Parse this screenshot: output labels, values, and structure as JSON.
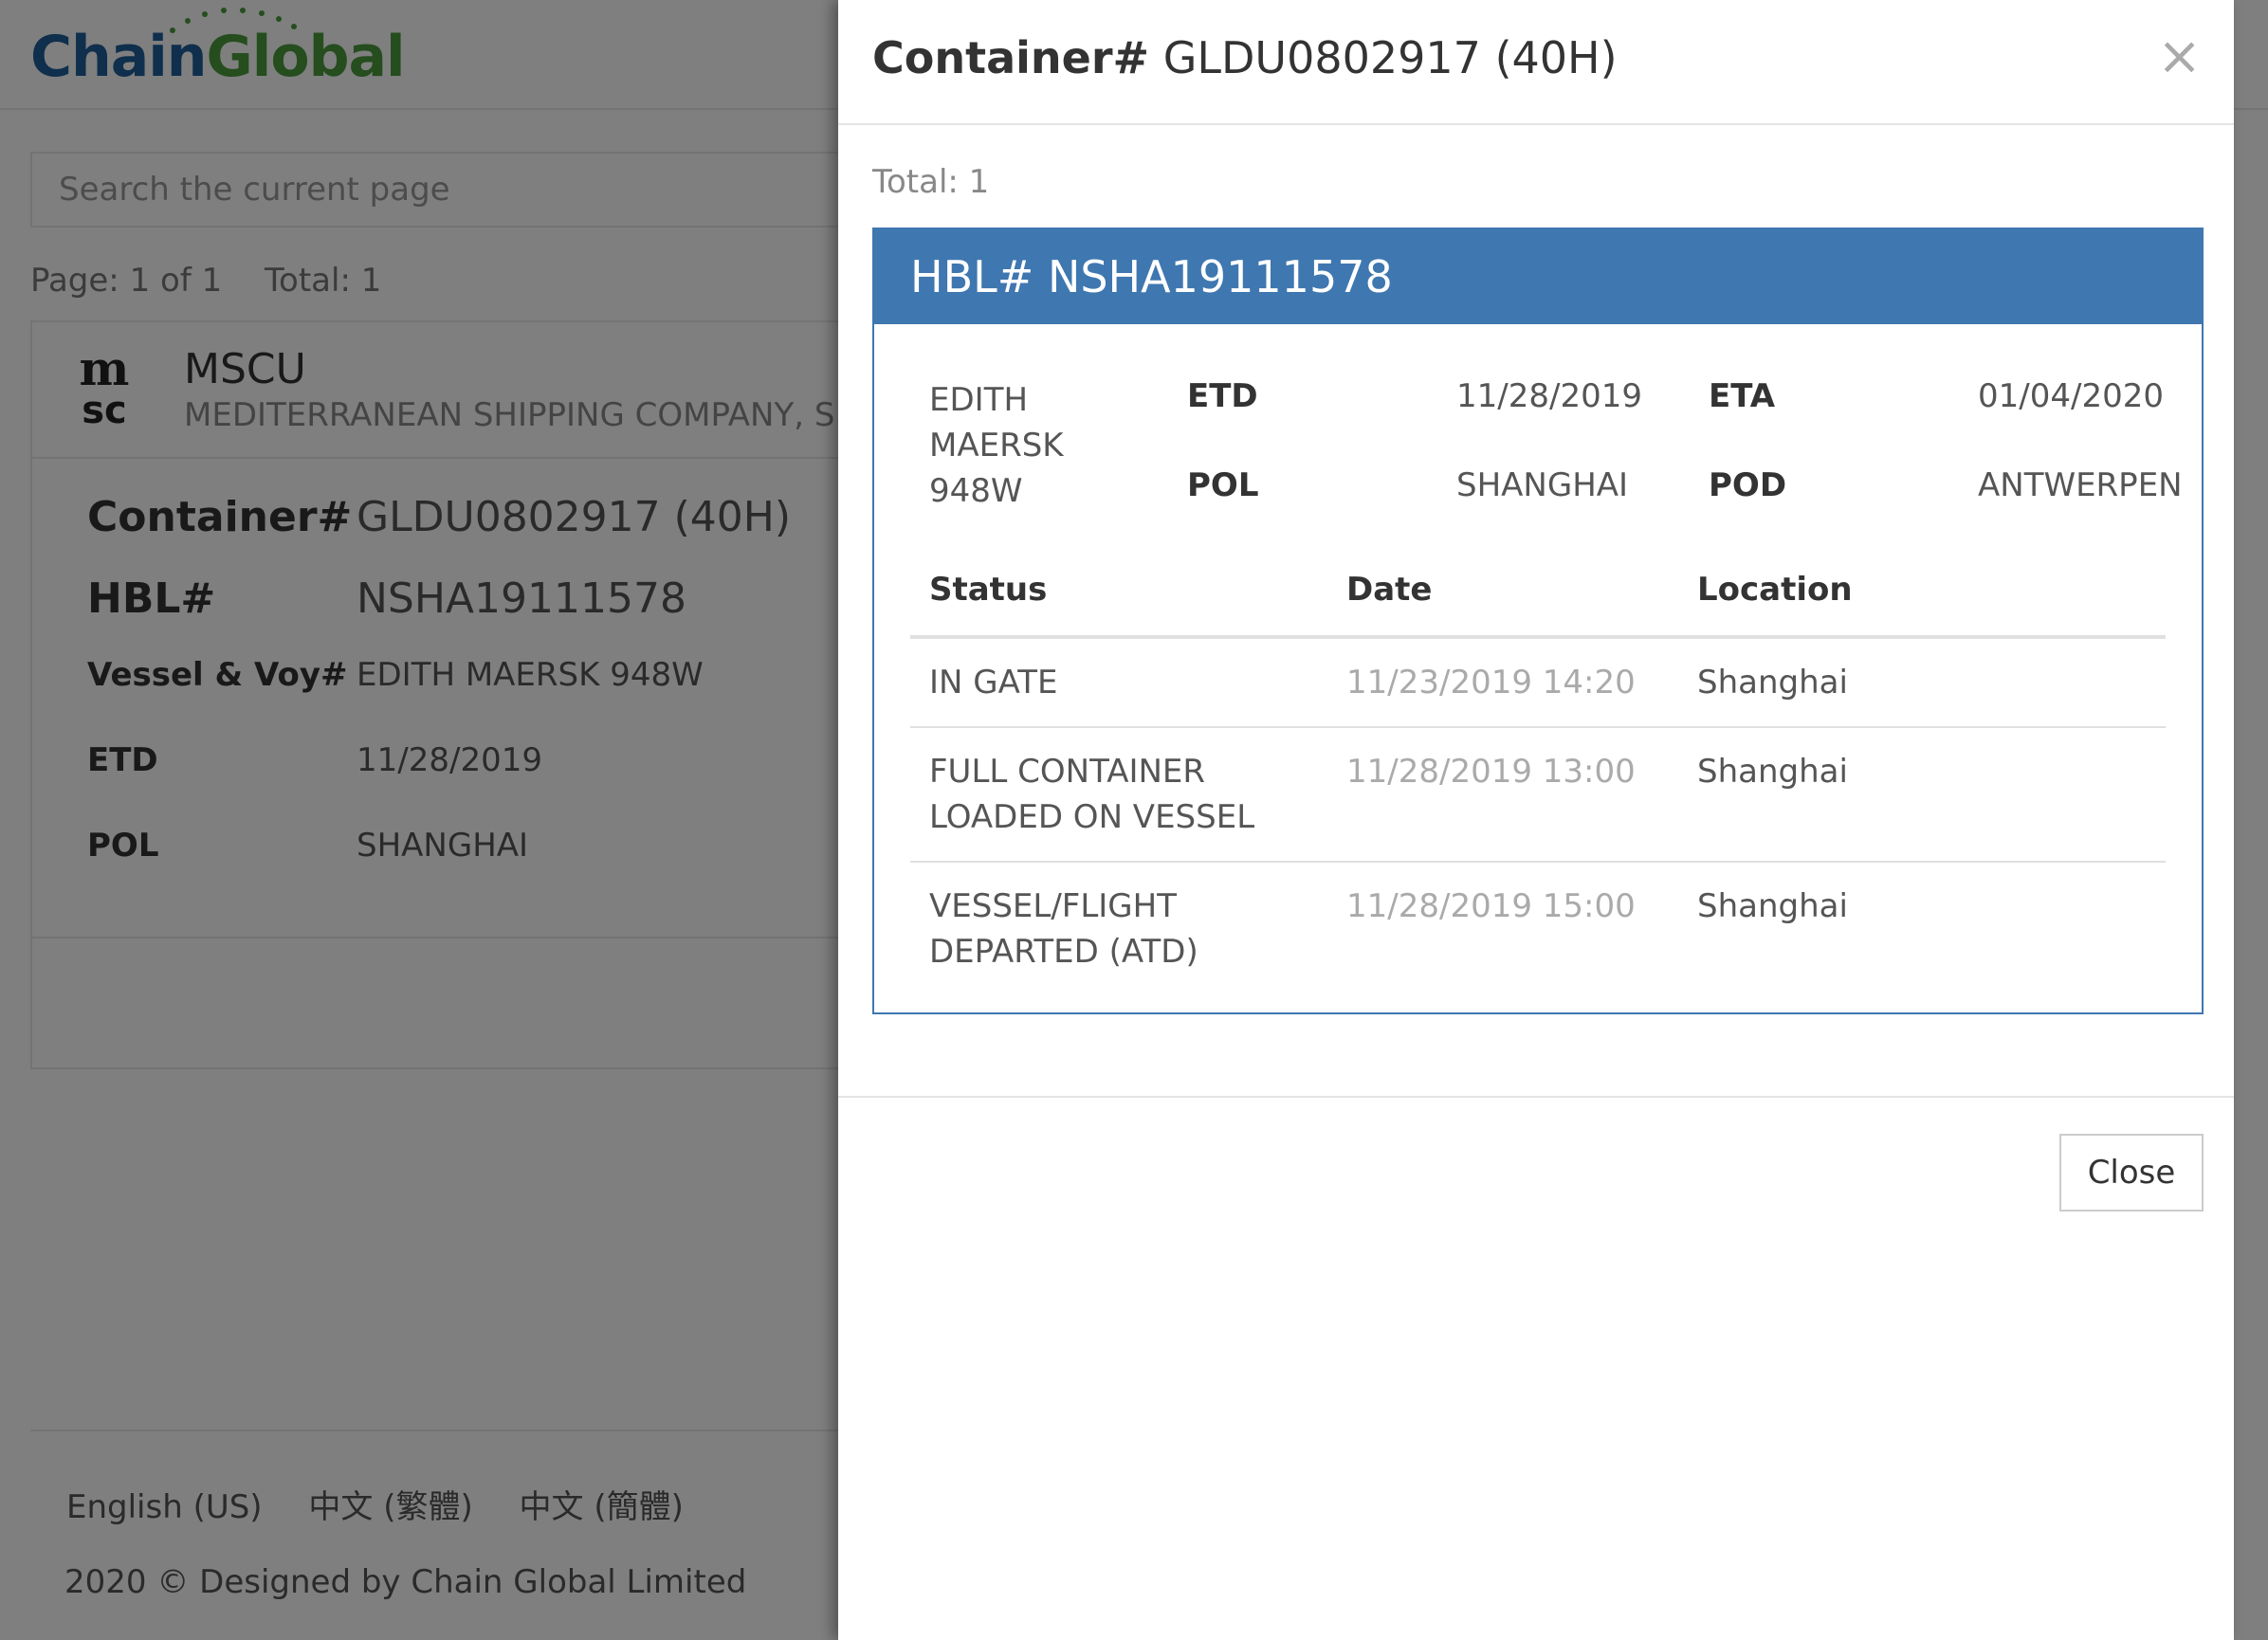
{
  "brand": {
    "logo_part1": "Chain",
    "logo_part2": "Global",
    "color_primary": "#1f5e9b",
    "color_secondary": "#4a9a3c"
  },
  "search": {
    "placeholder": "Search the current page"
  },
  "pagination": {
    "page": "Page: 1 of 1",
    "total": "Total: 1"
  },
  "result": {
    "carrier_code": "MSCU",
    "carrier_name": "MEDITERRANEAN SHIPPING COMPANY, S",
    "carrier_logo": "msc",
    "details": [
      {
        "label": "Container#",
        "value": "GLDU0802917 (40H)"
      },
      {
        "label": "HBL#",
        "value": "NSHA19111578"
      },
      {
        "label": "Vessel & Voy#",
        "value": "EDITH MAERSK 948W"
      },
      {
        "label": "ETD",
        "value": "11/28/2019"
      },
      {
        "label": "POL",
        "value": "SHANGHAI"
      }
    ]
  },
  "footer": {
    "languages": [
      "English (US)",
      "中文 (繁體)",
      "中文 (簡體)"
    ],
    "copyright": "2020 © Designed by Chain Global Limited"
  },
  "modal": {
    "title_label": "Container#",
    "title_value": "GLDU0802917 (40H)",
    "close_icon": "×",
    "total": "Total: 1",
    "hbl": {
      "header": "HBL# NSHA19111578",
      "vessel": "EDITH MAERSK 948W",
      "etd_label": "ETD",
      "etd": "11/28/2019",
      "eta_label": "ETA",
      "eta": "01/04/2020",
      "pol_label": "POL",
      "pol": "SHANGHAI",
      "pod_label": "POD",
      "pod": "ANTWERPEN",
      "columns": [
        "Status",
        "Date",
        "Location"
      ],
      "events": [
        {
          "status": "IN GATE",
          "date": "11/23/2019 14:20",
          "location": "Shanghai"
        },
        {
          "status": "FULL CONTAINER LOADED ON VESSEL",
          "date": "11/28/2019 13:00",
          "location": "Shanghai"
        },
        {
          "status": "VESSEL/FLIGHT DEPARTED (ATD)",
          "date": "11/28/2019 15:00",
          "location": "Shanghai"
        }
      ]
    },
    "close_button": "Close",
    "accent_color": "#3f77b0"
  }
}
